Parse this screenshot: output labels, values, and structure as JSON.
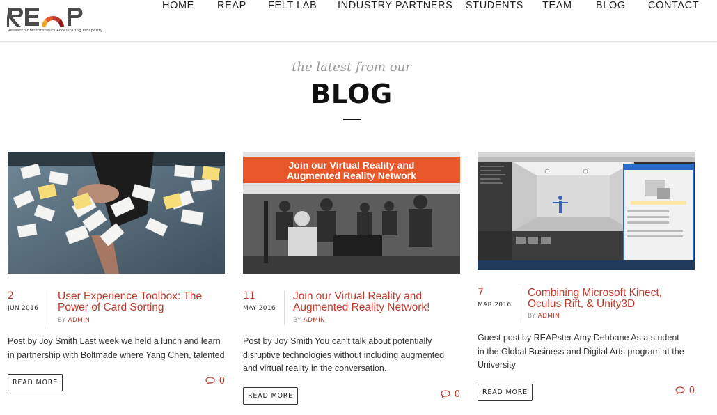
{
  "header": {
    "logo_text": "REAP",
    "logo_tagline": "Research Entrepreneurs Accelerating Prosperity",
    "nav": [
      "HOME",
      "REAP",
      "FELT LAB",
      "INDUSTRY PARTNERS",
      "STUDENTS",
      "TEAM",
      "BLOG",
      "CONTACT"
    ]
  },
  "section": {
    "kicker": "the latest from our",
    "title": "BLOG"
  },
  "posts": [
    {
      "day": "2",
      "month": "JUN 2016",
      "title": "User Experience Toolbox: The Power of Card Sorting",
      "by": "BY",
      "author": "ADMIN",
      "excerpt": "Post by Joy Smith Last week we held a lunch and learn in partnership with Boltmade where Yang Chen, talented",
      "read_more": "READ MORE",
      "comments": "0"
    },
    {
      "day": "11",
      "month": "MAY 2016",
      "title": "Join our Virtual Reality and Augmented Reality Network!",
      "by": "BY",
      "author": "ADMIN",
      "excerpt": "Post by Joy Smith You can't talk about potentially disruptive technologies without including augmented and virtual reality in the conversation.",
      "read_more": "READ MORE",
      "comments": "0",
      "image_banner": "Join our Virtual Reality and Augmented Reality Network"
    },
    {
      "day": "7",
      "month": "MAR 2016",
      "title": "Combining Microsoft Kinect, Oculus Rift, & Unity3D",
      "by": "BY",
      "author": "ADMIN",
      "excerpt": "Guest post by REAPster Amy Debbane As a student in the Global Business and Digital Arts program at the University",
      "read_more": "READ MORE",
      "comments": "0"
    }
  ],
  "colors": {
    "accent": "#c0392b",
    "text": "#333333",
    "nav": "#222222",
    "kicker": "#999999"
  }
}
